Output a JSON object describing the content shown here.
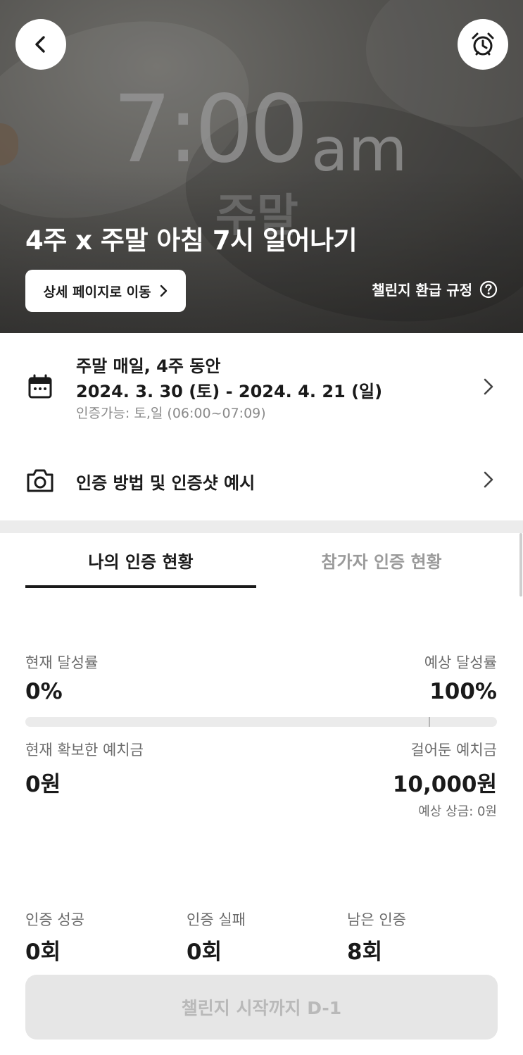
{
  "hero": {
    "bg_time": "7:00",
    "bg_ampm": "am",
    "bg_sub": "주말",
    "title": "4주 x 주말 아침 7시 일어나기",
    "detail_button": "상세 페이지로 이동",
    "refund_link": "챌린지 환급 규정",
    "icons": {
      "back": "chevron-left-icon",
      "alarm": "alarm-clock-icon",
      "help": "question-circle-icon",
      "detail_chevron": "chevron-right-icon"
    }
  },
  "schedule": {
    "frequency": "주말 매일, 4주 동안",
    "period": "2024. 3. 30 (토) - 2024. 4. 21 (일)",
    "verify_window": "인증가능: 토,일 (06:00~07:09)"
  },
  "method": {
    "label": "인증 방법 및 인증샷 예시"
  },
  "tabs": [
    {
      "label": "나의 인증 현황",
      "active": true
    },
    {
      "label": "참가자 인증 현황",
      "active": false
    }
  ],
  "stats": {
    "current_rate_label": "현재 달성률",
    "current_rate_value": "0%",
    "expected_rate_label": "예상 달성률",
    "expected_rate_value": "100%",
    "progress_fraction": 0.0,
    "marker_fraction": 0.855,
    "secured_deposit_label": "현재 확보한 예치금",
    "secured_deposit_value": "0원",
    "bet_deposit_label": "걸어둔 예치금",
    "bet_deposit_value": "10,000원",
    "expected_prize": "예상 상금: 0원"
  },
  "counts": [
    {
      "label": "인증 성공",
      "value": "0회"
    },
    {
      "label": "인증 실패",
      "value": "0회"
    },
    {
      "label": "남은 인증",
      "value": "8회"
    }
  ],
  "cta": {
    "label": "챌린지 시작까지 D-1"
  },
  "colors": {
    "primary_text": "#1a1a1a",
    "secondary_text": "#6b6b6b",
    "disabled_button_bg": "#e6e6e6",
    "disabled_button_text": "#b9b9b9"
  }
}
